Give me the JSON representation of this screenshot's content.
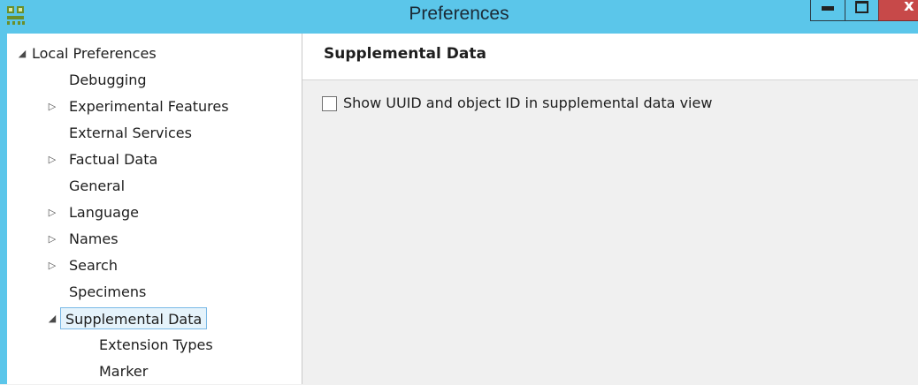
{
  "window": {
    "title": "Preferences",
    "controls": {
      "minimize_icon": "minimize-icon",
      "maximize_icon": "maximize-icon",
      "close_icon": "close-icon",
      "close_glyph": "x"
    },
    "app_icon": "app-logo-icon",
    "colors": {
      "titlebar": "#5bc6ea",
      "close_button": "#c74949",
      "selection": "#e5f3fb",
      "selection_border": "#7ab9e6"
    }
  },
  "tree": {
    "root": {
      "label": "Local Preferences",
      "expanded": true
    },
    "items": [
      {
        "label": "Debugging",
        "has_children": false
      },
      {
        "label": "Experimental Features",
        "has_children": true,
        "expanded": false
      },
      {
        "label": "External Services",
        "has_children": false
      },
      {
        "label": "Factual Data",
        "has_children": true,
        "expanded": false
      },
      {
        "label": "General",
        "has_children": false
      },
      {
        "label": "Language",
        "has_children": true,
        "expanded": false
      },
      {
        "label": "Names",
        "has_children": true,
        "expanded": false
      },
      {
        "label": "Search",
        "has_children": true,
        "expanded": false
      },
      {
        "label": "Specimens",
        "has_children": false
      },
      {
        "label": "Supplemental Data",
        "has_children": true,
        "expanded": true,
        "selected": true
      }
    ],
    "children_of_selected": [
      {
        "label": "Extension Types"
      },
      {
        "label": "Marker"
      }
    ]
  },
  "content": {
    "title": "Supplemental Data",
    "options": [
      {
        "label": "Show UUID and object ID in supplemental data view",
        "checked": false
      }
    ]
  }
}
